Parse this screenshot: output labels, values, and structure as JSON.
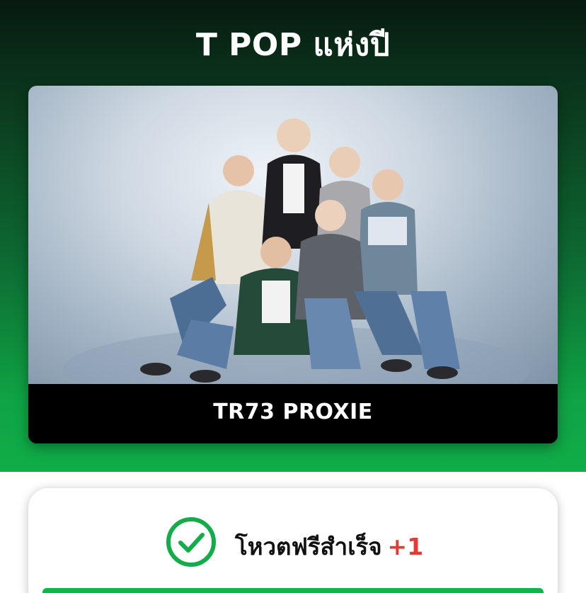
{
  "header": {
    "title": "T POP แห่งปี"
  },
  "nominee": {
    "name": "TR73 PROXIE",
    "photo_icon": "group-photo"
  },
  "vote_result": {
    "message": "โหวตฟรีสำเร็จ",
    "bonus": "+1",
    "icon": "check-circle-icon"
  },
  "colors": {
    "brand_green": "#10ad48",
    "dark_top": "#071a10",
    "bonus_red": "#e53935"
  }
}
